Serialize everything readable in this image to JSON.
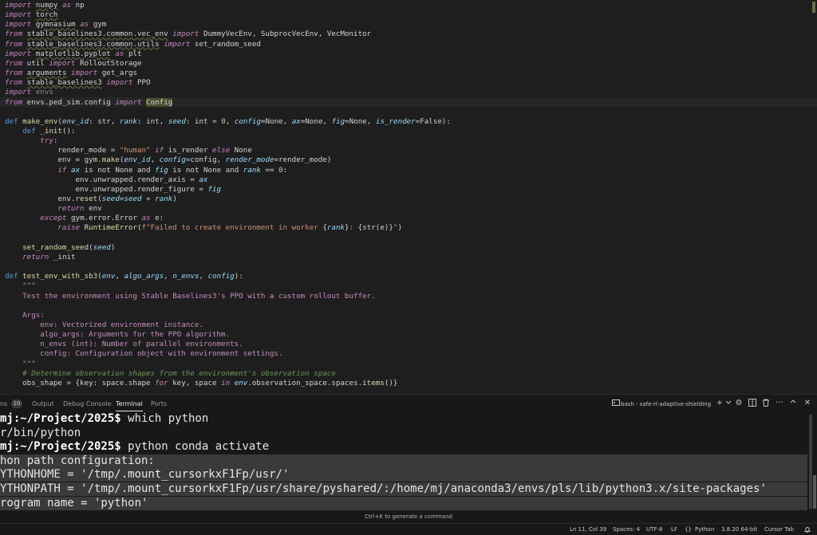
{
  "editor": {
    "lines": [
      {
        "parts": [
          [
            "kw",
            "import"
          ],
          [
            "t",
            " "
          ],
          [
            "mod",
            "numpy"
          ],
          [
            "t",
            " "
          ],
          [
            "kw",
            "as"
          ],
          [
            "t",
            " np"
          ]
        ]
      },
      {
        "parts": [
          [
            "kw",
            "import"
          ],
          [
            "t",
            " "
          ],
          [
            "mod",
            "torch"
          ]
        ]
      },
      {
        "parts": [
          [
            "kw",
            "import"
          ],
          [
            "t",
            " "
          ],
          [
            "mod",
            "gymnasium"
          ],
          [
            "t",
            " "
          ],
          [
            "kw",
            "as"
          ],
          [
            "t",
            " gym"
          ]
        ]
      },
      {
        "parts": [
          [
            "kw",
            "from"
          ],
          [
            "t",
            " "
          ],
          [
            "mod",
            "stable_baselines3.common.vec_env"
          ],
          [
            "t",
            " "
          ],
          [
            "kw",
            "import"
          ],
          [
            "t",
            " DummyVecEnv, SubprocVecEnv, VecMonitor"
          ]
        ]
      },
      {
        "parts": [
          [
            "kw",
            "from"
          ],
          [
            "t",
            " "
          ],
          [
            "mod",
            "stable_baselines3.common.utils"
          ],
          [
            "t",
            " "
          ],
          [
            "kw",
            "import"
          ],
          [
            "t",
            " set_random_seed"
          ]
        ]
      },
      {
        "parts": [
          [
            "kw",
            "import"
          ],
          [
            "t",
            " "
          ],
          [
            "mod",
            "matplotlib.pyplot"
          ],
          [
            "t",
            " "
          ],
          [
            "kw",
            "as"
          ],
          [
            "t",
            " plt"
          ]
        ]
      },
      {
        "parts": [
          [
            "kw",
            "from"
          ],
          [
            "t",
            " util "
          ],
          [
            "kw",
            "import"
          ],
          [
            "t",
            " RolloutStorage"
          ]
        ]
      },
      {
        "parts": [
          [
            "kw",
            "from"
          ],
          [
            "t",
            " "
          ],
          [
            "mod",
            "arguments"
          ],
          [
            "t",
            " "
          ],
          [
            "kw",
            "import"
          ],
          [
            "t",
            " get_args"
          ]
        ]
      },
      {
        "parts": [
          [
            "kw",
            "from"
          ],
          [
            "t",
            " "
          ],
          [
            "mod",
            "stable_baselines3"
          ],
          [
            "t",
            " "
          ],
          [
            "kw",
            "import"
          ],
          [
            "t",
            " PPO"
          ]
        ]
      },
      {
        "parts": [
          [
            "kw",
            "import"
          ],
          [
            "t",
            " "
          ],
          [
            "dim",
            "envs"
          ]
        ]
      },
      {
        "parts": [
          [
            "kw",
            "from"
          ],
          [
            "t",
            " envs.ped_sim.config "
          ],
          [
            "kw",
            "import"
          ],
          [
            "t",
            " "
          ],
          [
            "hl",
            "Config"
          ]
        ]
      },
      {
        "parts": []
      },
      {
        "parts": [
          [
            "kwb",
            "def"
          ],
          [
            "t",
            " "
          ],
          [
            "fn",
            "make_env"
          ],
          [
            "t",
            "("
          ],
          [
            "param",
            "env_id"
          ],
          [
            "t",
            ": str, "
          ],
          [
            "param",
            "rank"
          ],
          [
            "t",
            ": int, "
          ],
          [
            "param",
            "seed"
          ],
          [
            "t",
            ": int = "
          ],
          [
            "num",
            "0"
          ],
          [
            "t",
            ", "
          ],
          [
            "param",
            "config"
          ],
          [
            "t",
            "=None, "
          ],
          [
            "param",
            "ax"
          ],
          [
            "t",
            "=None, "
          ],
          [
            "param",
            "fig"
          ],
          [
            "t",
            "=None, "
          ],
          [
            "param",
            "is_render"
          ],
          [
            "t",
            "=False):"
          ]
        ]
      },
      {
        "parts": [
          [
            "t",
            "    "
          ],
          [
            "kwb",
            "def"
          ],
          [
            "t",
            " "
          ],
          [
            "fn",
            "_init"
          ],
          [
            "t",
            "():"
          ]
        ]
      },
      {
        "parts": [
          [
            "t",
            "        "
          ],
          [
            "kw",
            "try"
          ],
          [
            "t",
            ":"
          ]
        ]
      },
      {
        "parts": [
          [
            "t",
            "            render_mode = "
          ],
          [
            "str",
            "\"human\""
          ],
          [
            "t",
            " "
          ],
          [
            "kw",
            "if"
          ],
          [
            "t",
            " is_render "
          ],
          [
            "kw",
            "else"
          ],
          [
            "t",
            " None"
          ]
        ]
      },
      {
        "parts": [
          [
            "t",
            "            env = gym."
          ],
          [
            "fn",
            "make"
          ],
          [
            "t",
            "("
          ],
          [
            "param",
            "env_id"
          ],
          [
            "t",
            ", "
          ],
          [
            "param",
            "config"
          ],
          [
            "t",
            "=config, "
          ],
          [
            "param",
            "render_mode"
          ],
          [
            "t",
            "=render_mode)"
          ]
        ]
      },
      {
        "parts": [
          [
            "t",
            "            "
          ],
          [
            "kw",
            "if"
          ],
          [
            "t",
            " "
          ],
          [
            "param",
            "ax"
          ],
          [
            "t",
            " is not None and "
          ],
          [
            "param",
            "fig"
          ],
          [
            "t",
            " is not None and "
          ],
          [
            "param",
            "rank"
          ],
          [
            "t",
            " == "
          ],
          [
            "num",
            "0"
          ],
          [
            "t",
            ":"
          ]
        ]
      },
      {
        "parts": [
          [
            "t",
            "                env.unwrapped.render_axis = "
          ],
          [
            "param",
            "ax"
          ]
        ]
      },
      {
        "parts": [
          [
            "t",
            "                env.unwrapped.render_figure = "
          ],
          [
            "param",
            "fig"
          ]
        ]
      },
      {
        "parts": [
          [
            "t",
            "            env."
          ],
          [
            "fn",
            "reset"
          ],
          [
            "t",
            "("
          ],
          [
            "param",
            "seed"
          ],
          [
            "t",
            "="
          ],
          [
            "param",
            "seed"
          ],
          [
            "t",
            " + "
          ],
          [
            "param",
            "rank"
          ],
          [
            "t",
            ")"
          ]
        ]
      },
      {
        "parts": [
          [
            "t",
            "            "
          ],
          [
            "kw",
            "return"
          ],
          [
            "t",
            " env"
          ]
        ]
      },
      {
        "parts": [
          [
            "t",
            "        "
          ],
          [
            "kw",
            "except"
          ],
          [
            "t",
            " gym.error.Error "
          ],
          [
            "kw",
            "as"
          ],
          [
            "t",
            " e:"
          ]
        ]
      },
      {
        "parts": [
          [
            "t",
            "            "
          ],
          [
            "kw",
            "raise"
          ],
          [
            "t",
            " "
          ],
          [
            "fn",
            "RuntimeError"
          ],
          [
            "t",
            "("
          ],
          [
            "str",
            "f\"Failed to create environment in worker "
          ],
          [
            "t",
            "{"
          ],
          [
            "param",
            "rank"
          ],
          [
            "t",
            "}"
          ],
          [
            "str",
            ": "
          ],
          [
            "t",
            "{str(e)}"
          ],
          [
            "str",
            "\""
          ],
          [
            "t",
            ")"
          ]
        ]
      },
      {
        "parts": []
      },
      {
        "parts": [
          [
            "t",
            "    "
          ],
          [
            "fn",
            "set_random_seed"
          ],
          [
            "t",
            "("
          ],
          [
            "param",
            "seed"
          ],
          [
            "t",
            ")"
          ]
        ]
      },
      {
        "parts": [
          [
            "t",
            "    "
          ],
          [
            "kw",
            "return"
          ],
          [
            "t",
            " _init"
          ]
        ]
      },
      {
        "parts": []
      },
      {
        "parts": [
          [
            "kwb",
            "def"
          ],
          [
            "t",
            " "
          ],
          [
            "fn",
            "test_env_with_sb3"
          ],
          [
            "t",
            "("
          ],
          [
            "param",
            "env"
          ],
          [
            "t",
            ", "
          ],
          [
            "param",
            "algo_args"
          ],
          [
            "t",
            ", "
          ],
          [
            "param",
            "n_envs"
          ],
          [
            "t",
            ", "
          ],
          [
            "param",
            "config"
          ],
          [
            "t",
            "):"
          ]
        ]
      },
      {
        "parts": [
          [
            "t",
            "    "
          ],
          [
            "doc",
            "\"\"\""
          ]
        ]
      },
      {
        "parts": [
          [
            "t",
            "    "
          ],
          [
            "doc",
            "Test the environment using Stable Baselines3's PPO with a custom rollout buffer."
          ]
        ]
      },
      {
        "parts": []
      },
      {
        "parts": [
          [
            "t",
            "    "
          ],
          [
            "doc",
            "Args:"
          ]
        ]
      },
      {
        "parts": [
          [
            "t",
            "        "
          ],
          [
            "doc",
            "env: Vectorized environment instance."
          ]
        ]
      },
      {
        "parts": [
          [
            "t",
            "        "
          ],
          [
            "doc",
            "algo_args: Arguments for the PPO algorithm."
          ]
        ]
      },
      {
        "parts": [
          [
            "t",
            "        "
          ],
          [
            "doc",
            "n_envs (int): Number of parallel environments."
          ]
        ]
      },
      {
        "parts": [
          [
            "t",
            "        "
          ],
          [
            "doc",
            "config: Configuration object with environment settings."
          ]
        ]
      },
      {
        "parts": [
          [
            "t",
            "    "
          ],
          [
            "doc",
            "\"\"\""
          ]
        ]
      },
      {
        "parts": [
          [
            "t",
            "    "
          ],
          [
            "com",
            "# Determine observation shapes from the environment's observation space"
          ]
        ]
      },
      {
        "parts": [
          [
            "t",
            "    obs_shape = {key: space.shape "
          ],
          [
            "kw",
            "for"
          ],
          [
            "t",
            " key, space "
          ],
          [
            "kw",
            "in"
          ],
          [
            "t",
            " "
          ],
          [
            "param",
            "env"
          ],
          [
            "t",
            ".observation_space.spaces."
          ],
          [
            "fn",
            "items"
          ],
          [
            "t",
            "()}"
          ]
        ]
      }
    ]
  },
  "panel": {
    "problems_label_fragment": "ns",
    "problems_count": "10",
    "tabs": [
      "Output",
      "Debug Console",
      "Terminal",
      "Ports"
    ],
    "active_tab": "Terminal",
    "terminal_title": "bash - safe-rl-adaptive-shielding",
    "terminal_lines": [
      {
        "prefix": "mj:~/Project/2025$",
        "text": " which python",
        "selected": false
      },
      {
        "prefix": "",
        "text": "r/bin/python",
        "selected": false
      },
      {
        "prefix": "mj:~/Project/2025$",
        "text": " python conda activate",
        "selected": false
      },
      {
        "prefix": "",
        "text": "hon path configuration:",
        "selected": true
      },
      {
        "prefix": "",
        "text": "YTHONHOME = '/tmp/.mount_cursorkxF1Fp/usr/'",
        "selected": true
      },
      {
        "prefix": "",
        "text": "YTHONPATH = '/tmp/.mount_cursorkxF1Fp/usr/share/pyshared/:/home/mj/anaconda3/envs/pls/lib/python3.x/site-packages'",
        "selected": true
      },
      {
        "prefix": "",
        "text": "rogram name = 'python'",
        "selected": true
      }
    ]
  },
  "hint": "Ctrl+K to generate a command",
  "status": {
    "position": "Ln 11, Col 39",
    "spaces": "Spaces: 4",
    "encoding": "UTF-8",
    "eol": "LF",
    "language": "Python",
    "interpreter": "3.8.20 64-bit",
    "cursor_tab": "Cursor Tab"
  },
  "icons": [
    "plus-icon",
    "chevron-down-icon",
    "gear-icon",
    "split-terminal-icon",
    "trash-icon",
    "more-icon",
    "close-icon",
    "braces-icon",
    "bell-icon"
  ]
}
